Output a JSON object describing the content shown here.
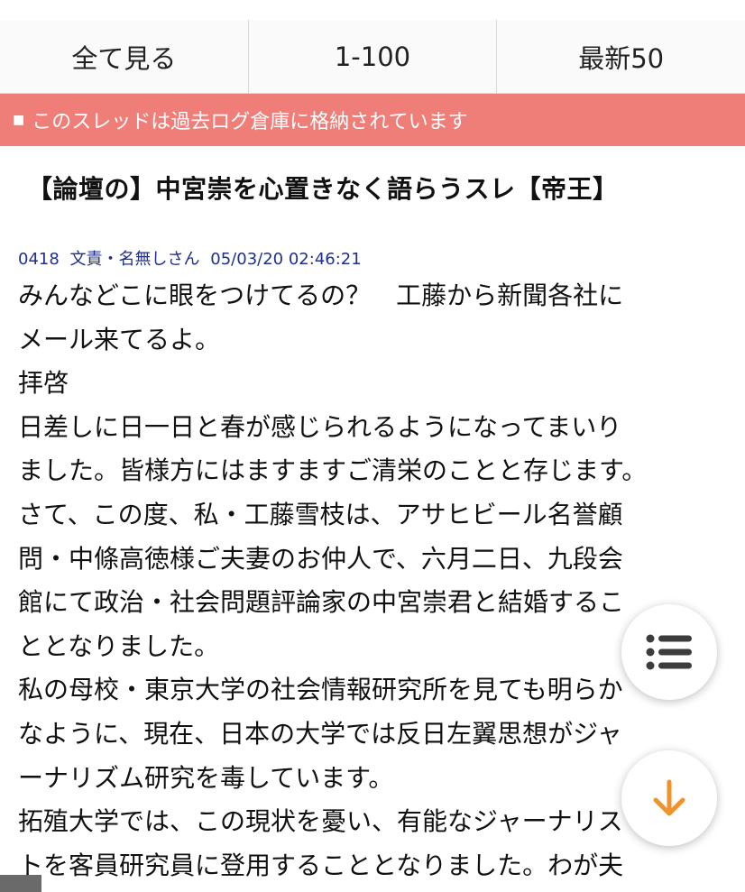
{
  "nav": {
    "all_label": "全て見る",
    "range_label": "1-100",
    "latest_label": "最新50"
  },
  "banner": {
    "icon": "square-icon",
    "text": "このスレッドは過去ログ倉庫に格納されています"
  },
  "thread": {
    "title": "【論壇の】中宮崇を心置きなく語らうスレ【帝王】"
  },
  "post": {
    "number": "0418",
    "name": "文責・名無しさん",
    "datetime": "05/03/20 02:46:21",
    "lines": [
      "みんなどこに眼をつけてるの？　工藤から新聞各社に",
      "メール来てるよ。",
      "拝啓",
      "日差しに日一日と春が感じられるようになってまいり",
      "ました。皆様方にはますますご清栄のことと存じます。",
      "さて、この度、私・工藤雪枝は、アサヒビール名誉顧",
      "問・中條高徳様ご夫妻のお仲人で、六月二日、九段会",
      "館にて政治・社会問題評論家の中宮崇君と結婚するこ",
      "ととなりました。",
      "私の母校・東京大学の社会情報研究所を見ても明らか",
      "なように、現在、日本の大学では反日左翼思想がジャ",
      "ーナリズム研究を毒しています。",
      "拓殖大学では、この現状を憂い、有能なジャーナリス",
      "トを客員研究員に登用することとなりました。わが夫"
    ]
  },
  "fab": {
    "menu_icon": "list-menu-icon",
    "scroll_icon": "arrow-down-icon",
    "accent_color": "#f0932b"
  },
  "colors": {
    "banner_bg": "#ef7d78",
    "header_text": "#1f2f8f"
  }
}
